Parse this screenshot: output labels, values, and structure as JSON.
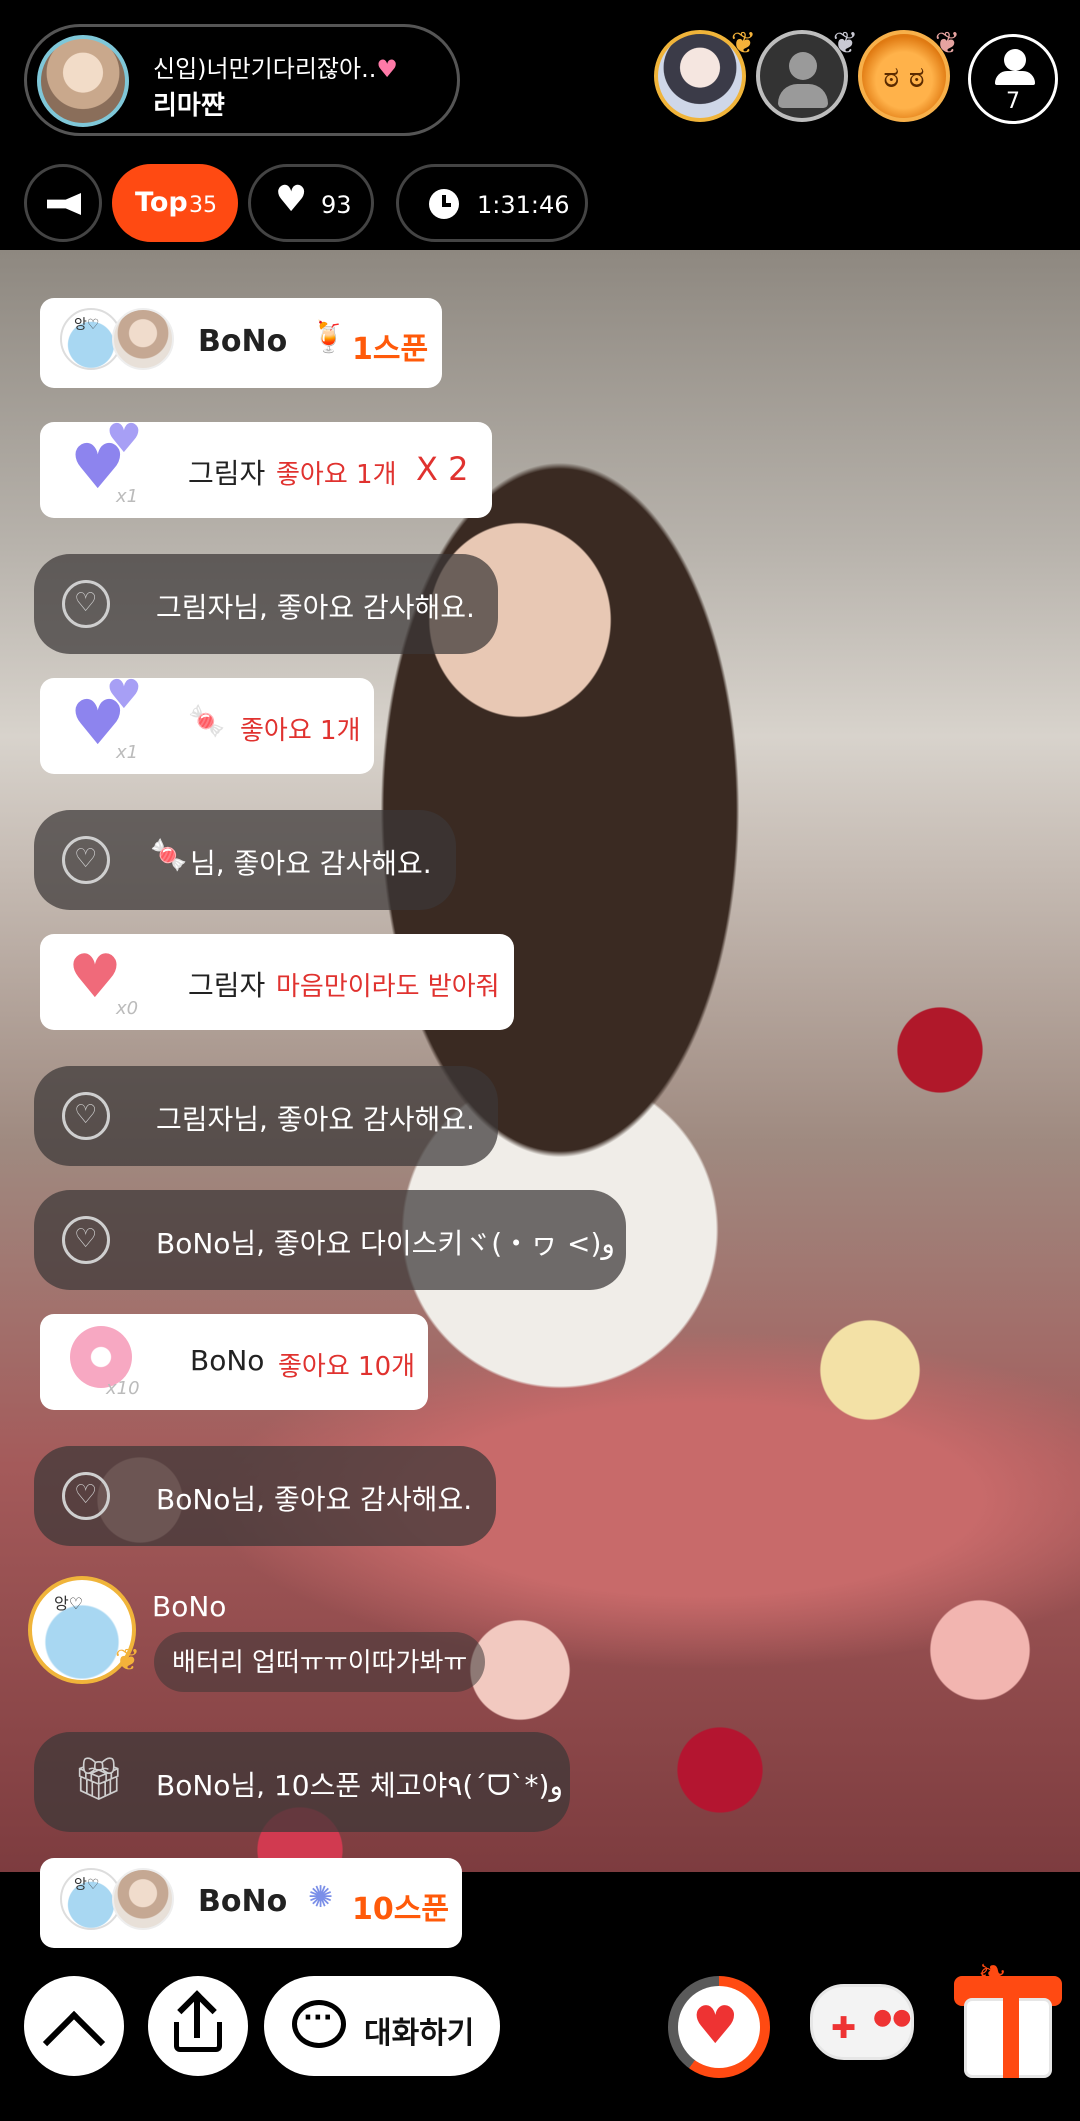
{
  "header": {
    "host_title": "신입)너만기다리잖아..",
    "host_name": "리마쨘",
    "viewer_count": "7",
    "top_label": "Top",
    "top_count": "35",
    "like_count": "93",
    "timer": "1:31:46"
  },
  "chat": [
    {
      "type": "spoon",
      "name": "BoNo",
      "amount": "1스푼"
    },
    {
      "type": "like_gift",
      "name": "그림자",
      "text": "좋아요 1개",
      "multiplier": "X 2",
      "xcount": "x1"
    },
    {
      "type": "system",
      "text": "그림자님, 좋아요 감사해요."
    },
    {
      "type": "like_gift",
      "name": "",
      "text": "좋아요 1개",
      "xcount": "x1"
    },
    {
      "type": "system",
      "text": "님, 좋아요 감사해요."
    },
    {
      "type": "like_gift",
      "name": "그림자",
      "text": "마음만이라도 받아줘",
      "xcount": "x0"
    },
    {
      "type": "system",
      "text": "그림자님, 좋아요 감사해요."
    },
    {
      "type": "system",
      "text": "BoNo님, 좋아요 다이스키ヾ(・ヮ <)و"
    },
    {
      "type": "like_gift",
      "name": "BoNo",
      "text": "좋아요 10개",
      "xcount": "x10"
    },
    {
      "type": "system",
      "text": "BoNo님, 좋아요 감사해요."
    },
    {
      "type": "message",
      "name": "BoNo",
      "text": "배터리 업떠ㅠㅠ이따가봐ㅠ"
    },
    {
      "type": "system_gift",
      "text": "BoNo님, 10스푼 체고야٩(ˊᗜˋ*)و"
    },
    {
      "type": "spoon",
      "name": "BoNo",
      "amount": "10스푼"
    }
  ],
  "avatar_caption": "앙♡",
  "footer": {
    "talk_label": "대화하기",
    "like_progress": 0.6
  },
  "colors": {
    "accent": "#ff4a12",
    "like_text": "#e0322f",
    "gift_heart": "#8d84ee"
  },
  "icons": [
    "megaphone-icon",
    "heart-icon",
    "clock-icon",
    "chevron-up-icon",
    "share-icon",
    "chat-bubble-icon",
    "gamepad-icon",
    "gift-box-icon"
  ]
}
